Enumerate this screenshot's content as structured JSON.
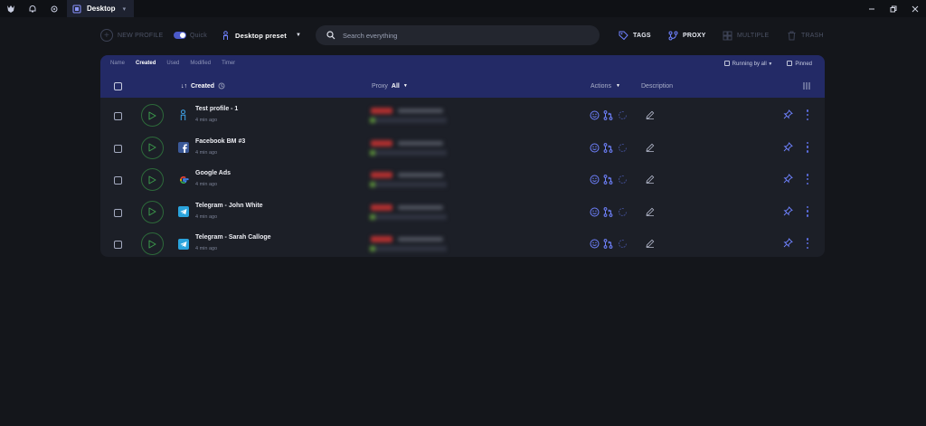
{
  "titlebar": {
    "tab_label": "Desktop",
    "tab_add": "▾",
    "icons": [
      "app-logo-icon",
      "bell-icon",
      "gear-icon"
    ],
    "window_controls": [
      "minimize-icon",
      "restore-icon",
      "close-icon"
    ]
  },
  "toolbar": {
    "new_profile": "NEW PROFILE",
    "quick": "Quick",
    "preset": "Desktop preset",
    "search_placeholder": "Search everything",
    "tags": "TAGS",
    "proxy": "PROXY",
    "multiple": "MULTIPLE",
    "trash": "TRASH"
  },
  "table": {
    "sort_tabs": [
      "Name",
      "Created",
      "Used",
      "Modified",
      "Timer"
    ],
    "active_sort": "Created",
    "running_by_all": "Running by all",
    "pinned": "Pinned",
    "col_created": "Created",
    "col_proxy": "Proxy",
    "col_proxy_filter": "All",
    "col_actions": "Actions",
    "col_description": "Description"
  },
  "profiles": [
    {
      "name": "Test profile - 1",
      "time": "4 min ago",
      "icon": "person-icon"
    },
    {
      "name": "Facebook BM #3",
      "time": "4 min ago",
      "icon": "facebook-icon"
    },
    {
      "name": "Google Ads",
      "time": "4 min ago",
      "icon": "google-icon"
    },
    {
      "name": "Telegram - John White",
      "time": "4 min ago",
      "icon": "telegram-icon"
    },
    {
      "name": "Telegram - Sarah Calloge",
      "time": "4 min ago",
      "icon": "telegram-icon"
    }
  ],
  "colors": {
    "accent": "#4b5ac9",
    "header": "#232a66",
    "play": "#3c9a4c"
  }
}
